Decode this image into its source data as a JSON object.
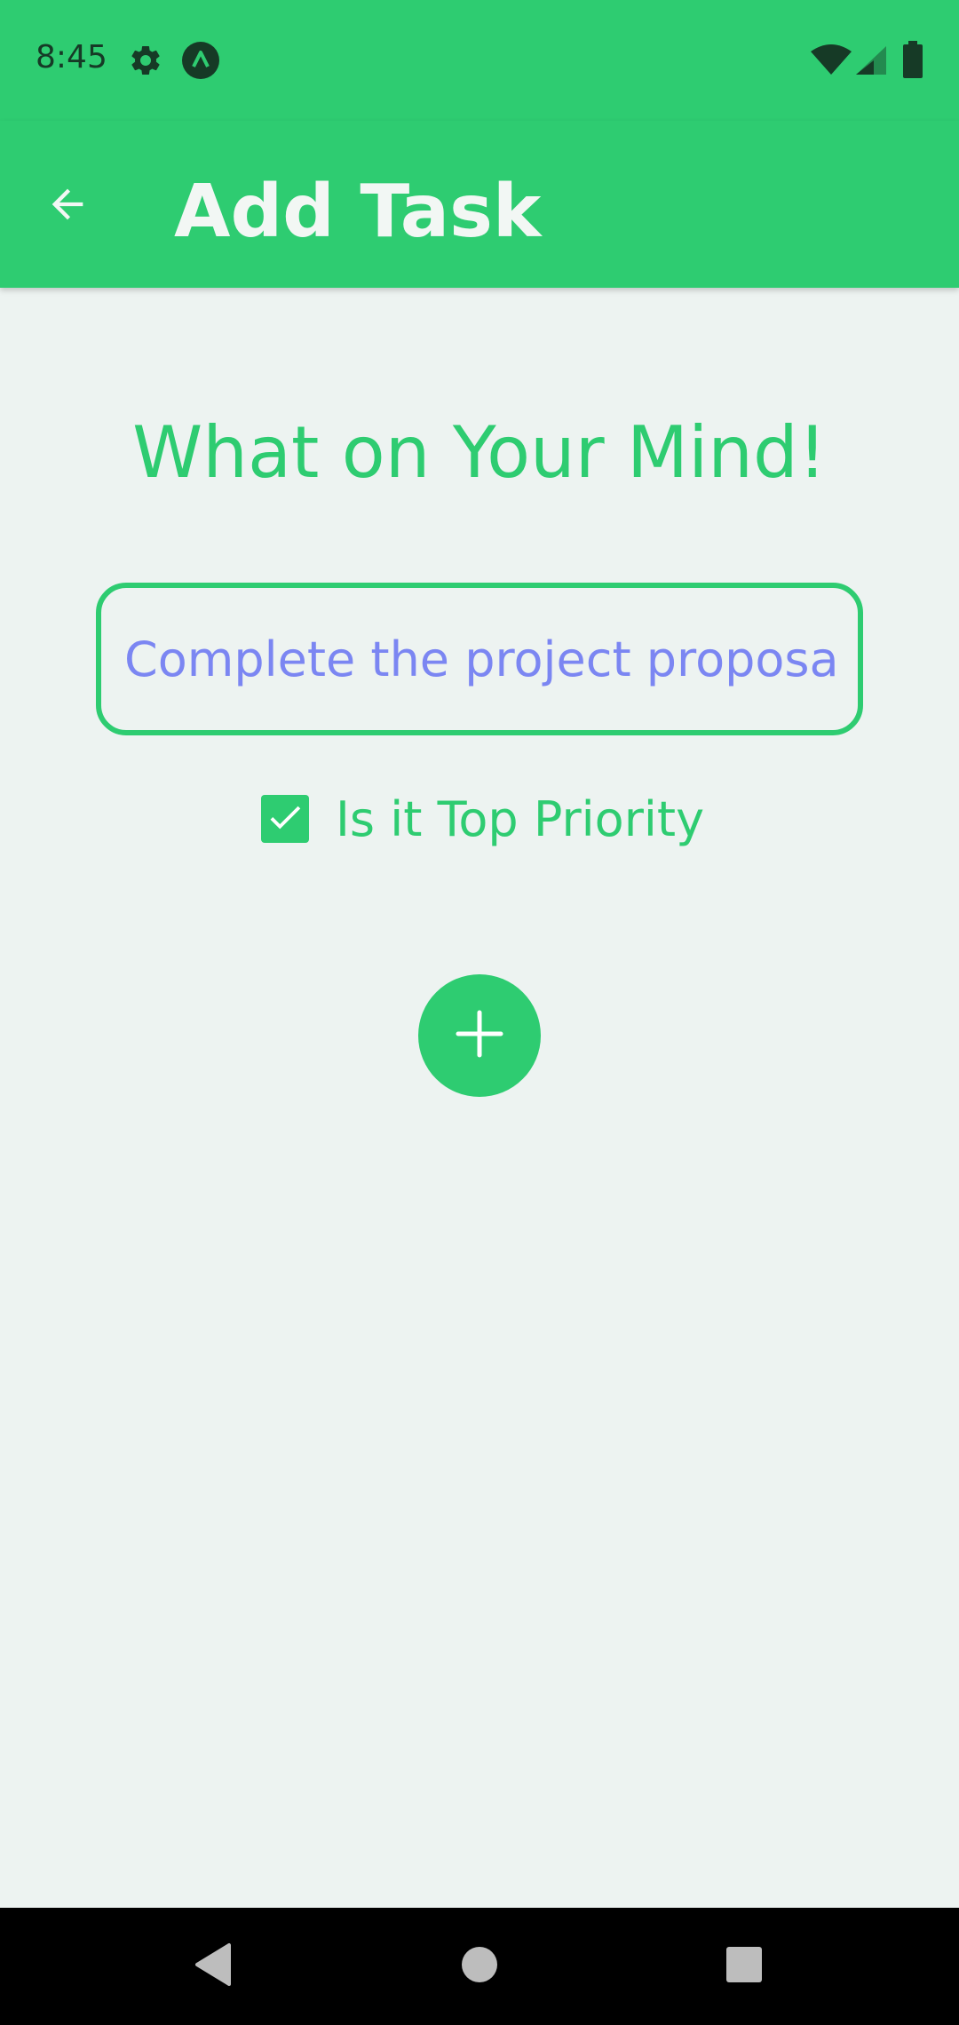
{
  "status_bar": {
    "time": "8:45",
    "icons": [
      "settings-gear-icon",
      "app-notification-icon",
      "wifi-icon",
      "cell-signal-icon",
      "battery-icon"
    ]
  },
  "app_bar": {
    "title": "Add Task",
    "back_icon": "arrow-left-icon"
  },
  "form": {
    "heading": "What on Your Mind!",
    "task_input": {
      "value": "Complete the project proposal",
      "placeholder": ""
    },
    "priority": {
      "label": "Is it Top Priority",
      "checked": true
    },
    "add_button_icon": "plus-icon"
  },
  "nav_bar": {
    "buttons": [
      "back-triangle-icon",
      "home-circle-icon",
      "recents-square-icon"
    ]
  },
  "colors": {
    "primary": "#2ECC71",
    "background": "#EDF3F1",
    "input_text": "#7B86F2",
    "cursor": "#26C6DA",
    "status_icons": "#163A26"
  }
}
